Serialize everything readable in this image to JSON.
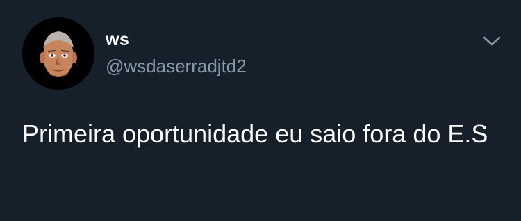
{
  "tweet": {
    "author": {
      "display_name": "ws",
      "handle": "@wsdaserradjtd2",
      "avatar": "profile-avatar-cartoon-face"
    },
    "menu_icon": "chevron-down-icon",
    "text": "Primeira oportunidade eu saio fora do E.S"
  },
  "colors": {
    "background": "#15202b",
    "primary_text": "#ffffff",
    "secondary_text": "#8899a6"
  }
}
